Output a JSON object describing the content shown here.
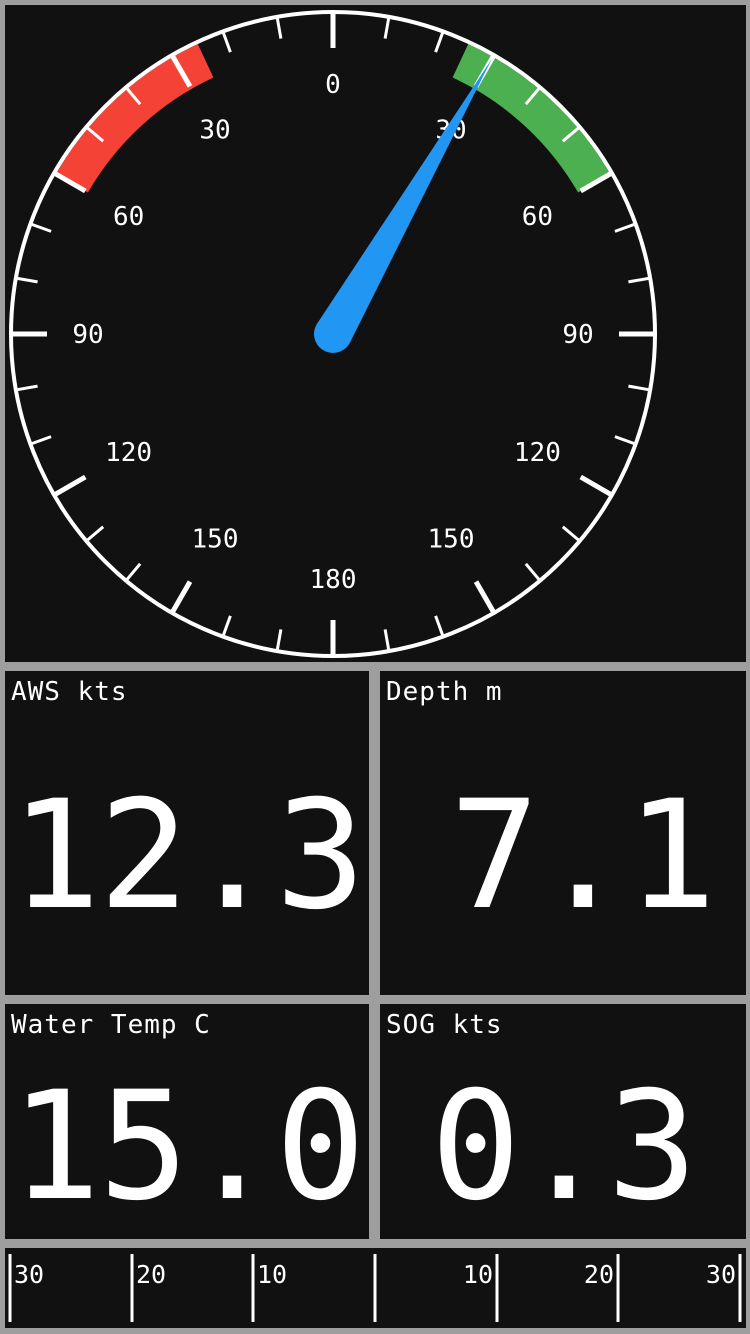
{
  "gauge": {
    "scale_labels": [
      "0",
      "30",
      "30",
      "60",
      "60",
      "90",
      "90",
      "120",
      "120",
      "150",
      "150",
      "180"
    ],
    "needle_angle_value": 30,
    "colors": {
      "dial": "#ffffff",
      "port_arc": "#f44336",
      "starboard_arc": "#4caf50",
      "needle": "#2196f3",
      "background": "#111111"
    }
  },
  "tiles": {
    "aws": {
      "label": "AWS kts",
      "value": "12.3"
    },
    "depth": {
      "label": "Depth m",
      "value": "7.1"
    },
    "water_temp": {
      "label": "Water Temp C",
      "value": "15.0"
    },
    "sog": {
      "label": "SOG kts",
      "value": "0.3"
    }
  },
  "strip": {
    "labels": [
      "30",
      "20",
      "10",
      "10",
      "20",
      "30"
    ]
  }
}
